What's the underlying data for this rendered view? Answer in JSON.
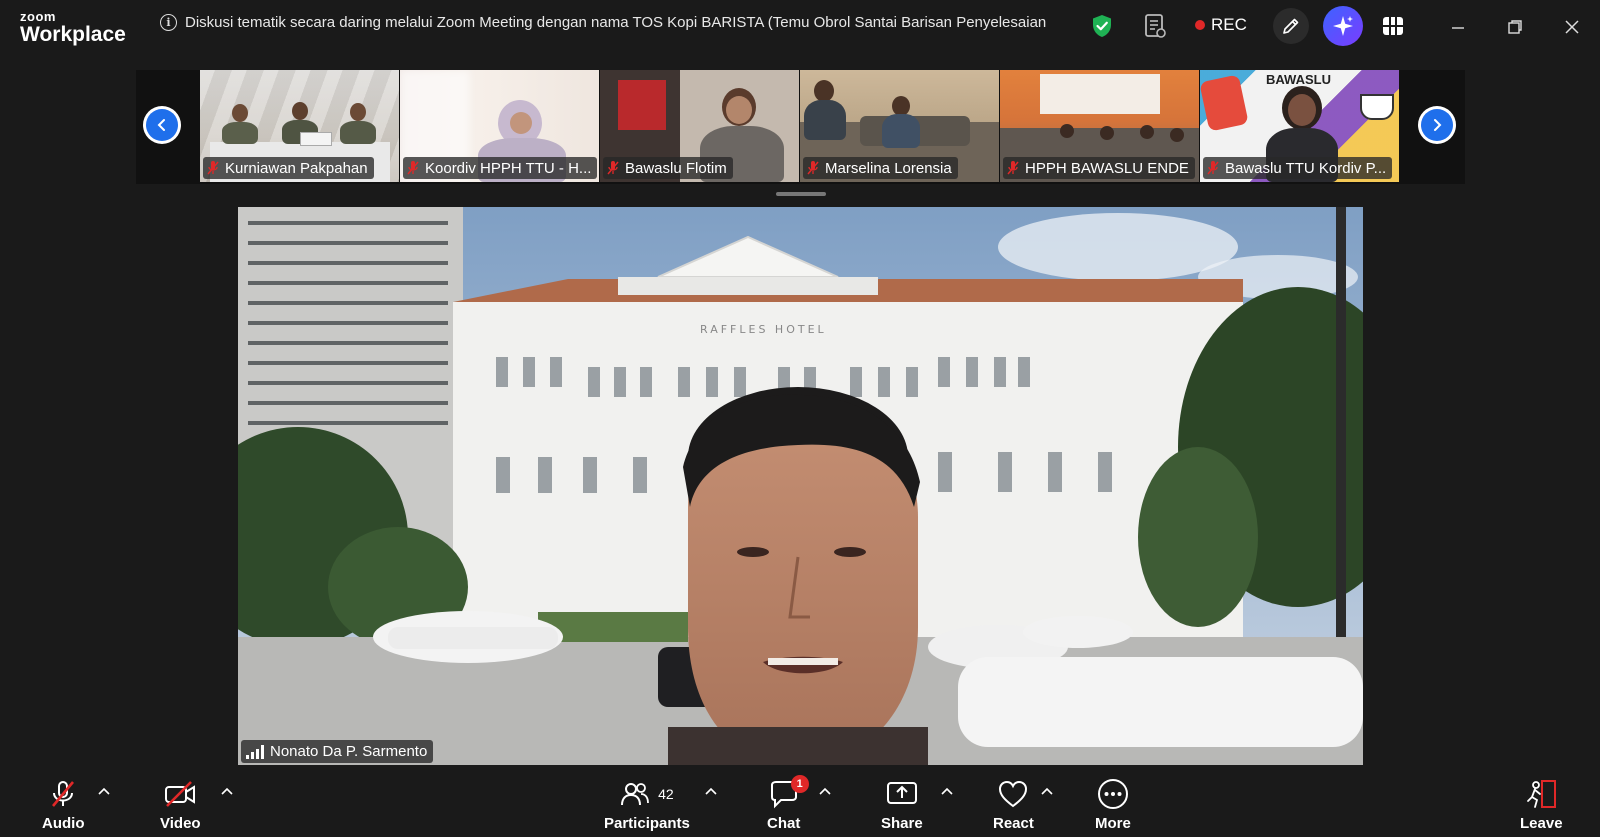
{
  "app": {
    "logo_top": "zoom",
    "logo_bottom": "Workplace"
  },
  "meeting": {
    "title": "Diskusi tematik secara daring melalui Zoom Meeting dengan nama TOS Kopi BARISTA (Temu Obrol Santai Barisan Penyelesaian Ser",
    "rec_label": "REC",
    "colors": {
      "rec": "#e02828",
      "shield": "#1fb254",
      "nav": "#1f6feb"
    }
  },
  "thumbnails": [
    {
      "name": "Kurniawan Pakpahan",
      "muted": true
    },
    {
      "name": "Koordiv HPPH TTU - H...",
      "muted": true
    },
    {
      "name": "Bawaslu Flotim",
      "muted": true
    },
    {
      "name": "Marselina Lorensia",
      "muted": true
    },
    {
      "name": "HPPH BAWASLU ENDE",
      "muted": true
    },
    {
      "name": "Bawaslu TTU Kordiv P...",
      "muted": true,
      "background_text": "BAWASLU"
    }
  ],
  "main_video": {
    "speaker_name": "Nonato Da P. Sarmento",
    "background_sign": "RAFFLES HOTEL"
  },
  "toolbar": {
    "audio": "Audio",
    "video": "Video",
    "participants": "Participants",
    "participants_count": "42",
    "chat": "Chat",
    "chat_badge": "1",
    "share": "Share",
    "react": "React",
    "more": "More",
    "leave": "Leave"
  }
}
